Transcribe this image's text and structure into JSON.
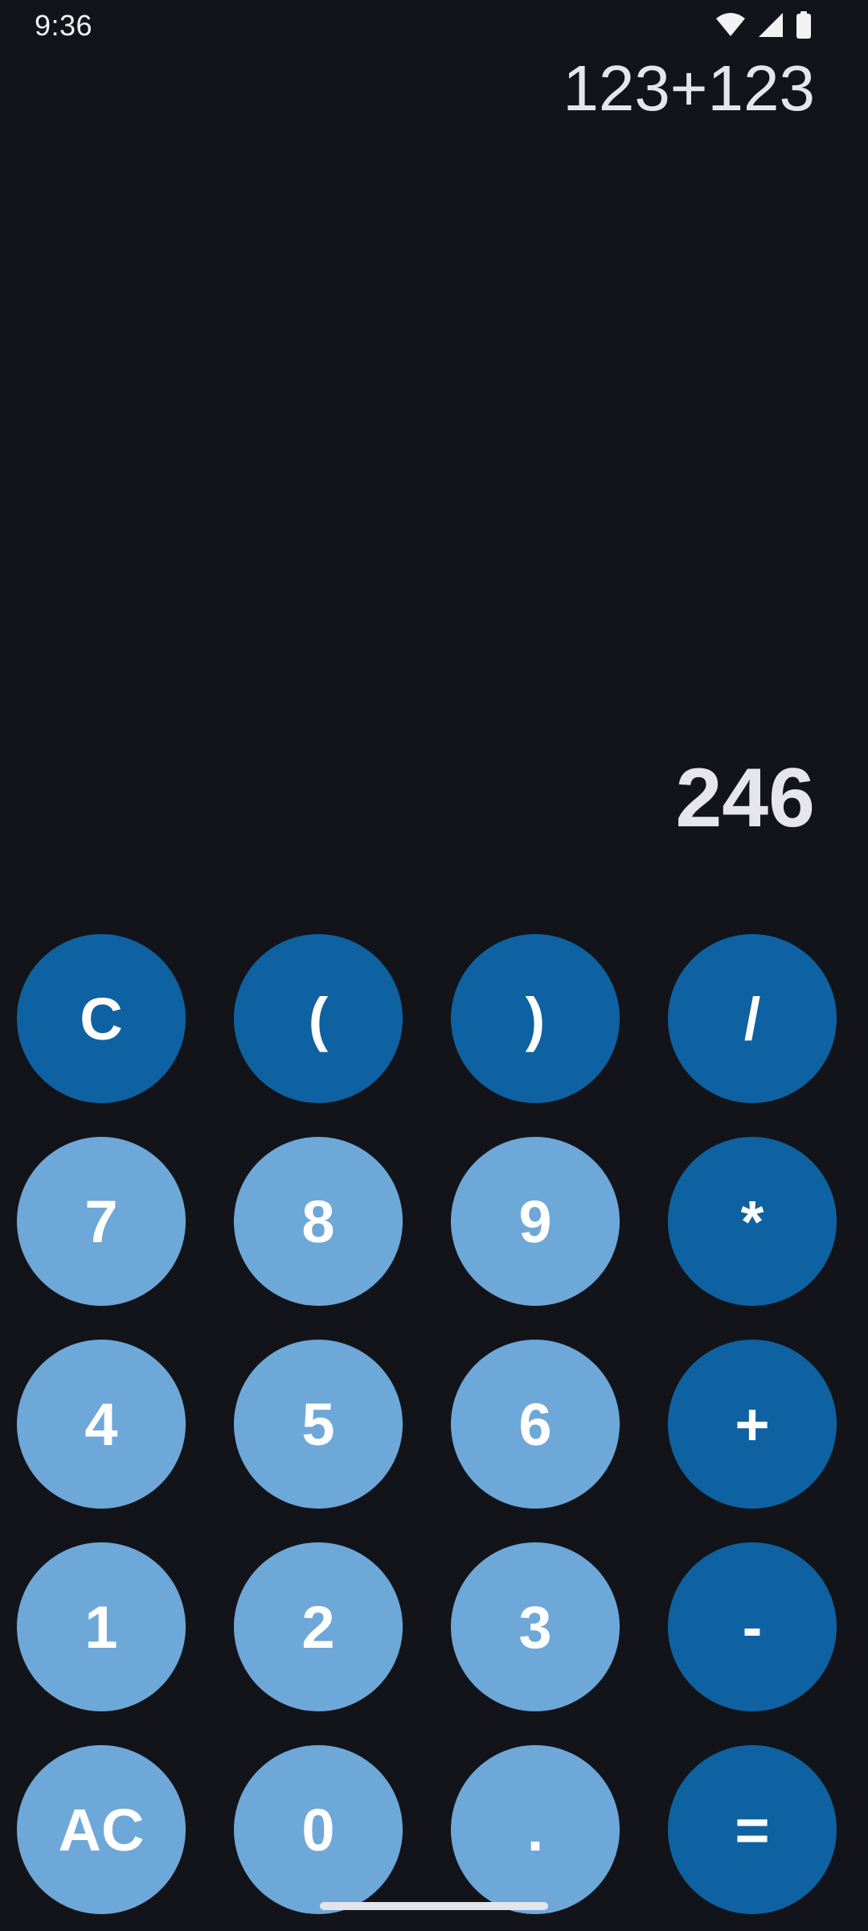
{
  "status_bar": {
    "time": "9:36",
    "icons": [
      "wifi-icon",
      "signal-icon",
      "battery-icon"
    ]
  },
  "display": {
    "expression": "123+123",
    "result": "246"
  },
  "keypad": {
    "rows": [
      [
        "C",
        "(",
        ")",
        "/"
      ],
      [
        "7",
        "8",
        "9",
        "*"
      ],
      [
        "4",
        "5",
        "6",
        "+"
      ],
      [
        "1",
        "2",
        "3",
        "-"
      ],
      [
        "AC",
        "0",
        ".",
        "="
      ]
    ]
  },
  "colors": {
    "background": "#12141a",
    "operator_key": "#0e62a1",
    "digit_key": "#6ea8d8",
    "key_text": "#ffffff",
    "display_text": "#e6e6ea"
  }
}
